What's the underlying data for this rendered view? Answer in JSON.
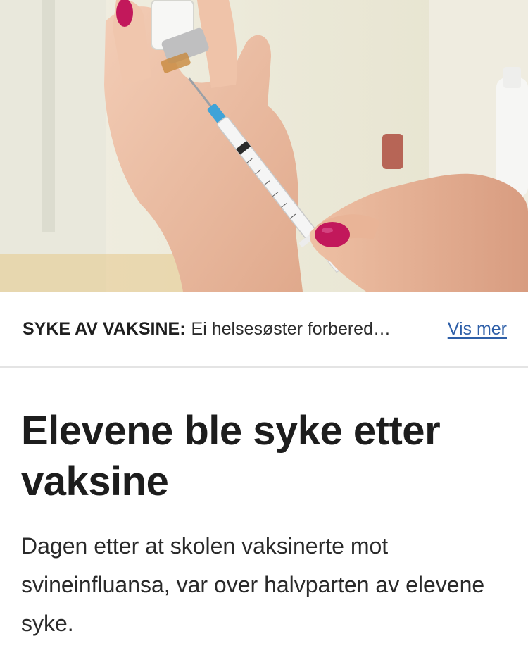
{
  "hero": {
    "image_description_icon": "vaccine-syringe-photo-icon"
  },
  "caption": {
    "label": "SYKE AV VAKSINE:",
    "text": "Ei helsesøster forbered…",
    "more_link": "Vis mer"
  },
  "article": {
    "headline": "Elevene ble syke etter vaksine",
    "lead": "Dagen etter at skolen vaksinerte mot svineinfluansa, var over halvparten av elevene syke."
  },
  "colors": {
    "link": "#2e5fa8",
    "nail_polish": "#c2185b",
    "divider": "#e4e4e4"
  }
}
